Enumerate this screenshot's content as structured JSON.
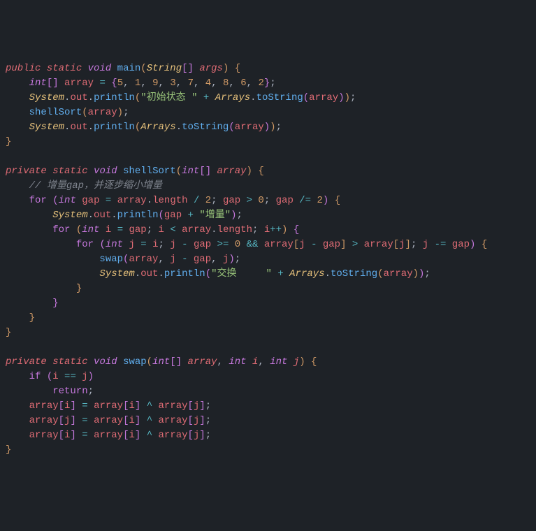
{
  "code": {
    "method_main": {
      "modifiers": [
        "public",
        "static"
      ],
      "return_type": "void",
      "name": "main",
      "param_type": "String",
      "param_name": "args",
      "array_decl_type": "int",
      "array_var": "array",
      "array_values": [
        "5",
        "1",
        "9",
        "3",
        "7",
        "4",
        "8",
        "6",
        "2"
      ],
      "print1_prefix": "初始状态 ",
      "print_class": "System",
      "print_field": "out",
      "print_method": "println",
      "arrays_class": "Arrays",
      "tostring_method": "toString",
      "call_shellsort": "shellSort"
    },
    "method_shellsort": {
      "modifiers": [
        "private",
        "static"
      ],
      "return_type": "void",
      "name": "shellSort",
      "param_type": "int",
      "param_name": "array",
      "comment": "// 增量gap，并逐步缩小增量",
      "outer_for_var": "gap",
      "outer_init_field": "length",
      "outer_divisor": "2",
      "outer_cond_val": "0",
      "outer_step_val": "2",
      "print_gap_suffix": "增量",
      "mid_for_var": "i",
      "inner_for_var": "j",
      "inner_cond_val": "0",
      "swap_call": "swap",
      "print_swap_prefix": "交换     "
    },
    "method_swap": {
      "modifiers": [
        "private",
        "static"
      ],
      "return_type": "void",
      "name": "swap",
      "param_type_arr": "int",
      "param_name_arr": "array",
      "param_type_i": "int",
      "param_name_i": "i",
      "param_type_j": "int",
      "param_name_j": "j",
      "return_kw": "return"
    },
    "if_kw": "if",
    "for_kw": "for"
  }
}
